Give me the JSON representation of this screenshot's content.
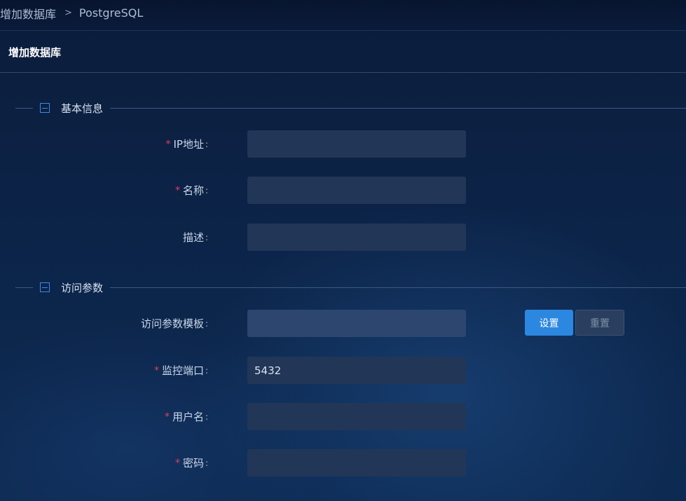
{
  "breadcrumb": {
    "parent": "增加数据库",
    "separator": ">",
    "current": "PostgreSQL"
  },
  "panel": {
    "title": "增加数据库"
  },
  "sections": {
    "basic": {
      "title": "基本信息"
    },
    "access": {
      "title": "访问参数"
    }
  },
  "fields": {
    "ip": {
      "label": "IP地址",
      "required": true,
      "value": "",
      "placeholder": ""
    },
    "name": {
      "label": "名称",
      "required": true,
      "value": "",
      "placeholder": ""
    },
    "description": {
      "label": "描述",
      "required": false,
      "value": "",
      "placeholder": ""
    },
    "template": {
      "label": "访问参数模板",
      "required": false,
      "value": "",
      "placeholder": ""
    },
    "port": {
      "label": "监控端口",
      "required": true,
      "value": "5432",
      "placeholder": ""
    },
    "username": {
      "label": "用户名",
      "required": true,
      "value": "",
      "placeholder": ""
    },
    "password": {
      "label": "密码",
      "required": true,
      "value": "",
      "placeholder": ""
    }
  },
  "buttons": {
    "set": "设置",
    "reset": "重置"
  },
  "label_colon": ":",
  "required_mark": "*",
  "icons": {
    "collapse": "minus-square-icon"
  },
  "colors": {
    "accent": "#2c87e0",
    "required": "#e0405a",
    "field_bg": "#223658"
  }
}
